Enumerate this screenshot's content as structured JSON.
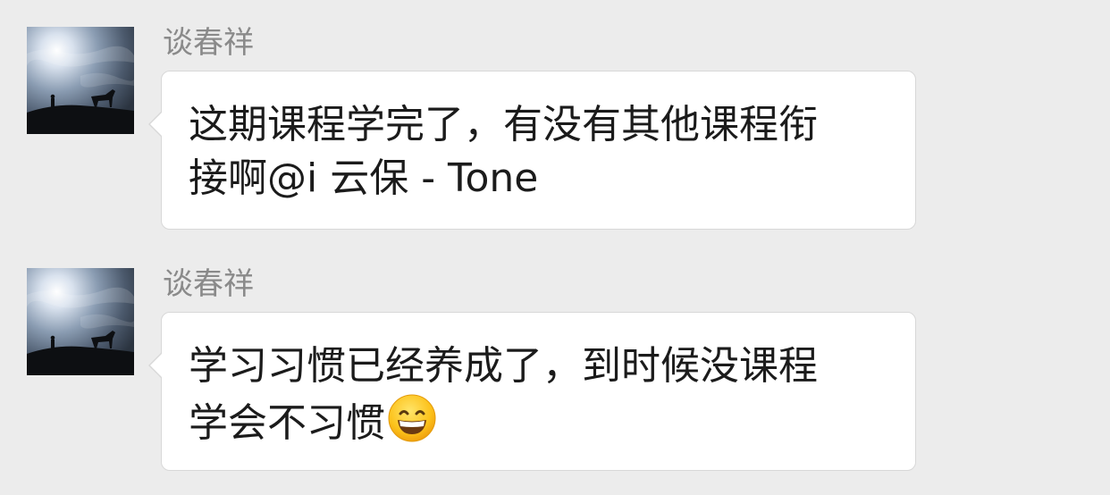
{
  "messages": [
    {
      "sender": "谈春祥",
      "avatar": "landscape-avatar",
      "lines": [
        "这期课程学完了，有没有其他课程衔",
        "接啊@i 云保 - Tone"
      ]
    },
    {
      "sender": "谈春祥",
      "avatar": "landscape-avatar",
      "lines": [
        "学习习惯已经养成了，到时候没课程",
        "学会不习惯"
      ],
      "emoji": "grinning-smiling-eyes-emoji"
    }
  ],
  "colors": {
    "background": "#ececec",
    "bubble": "#ffffff",
    "sender_name": "#8a8a8a",
    "message_text": "#1b1b1b"
  }
}
